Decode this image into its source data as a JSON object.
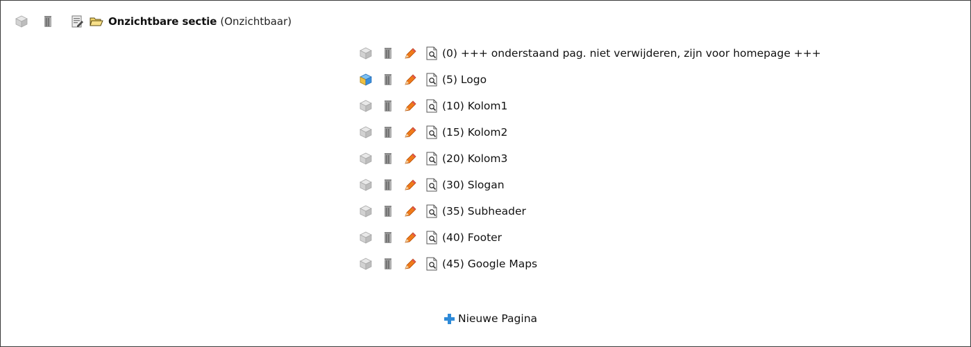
{
  "section": {
    "title": "Onzichtbare sectie",
    "subtitle": "(Onzichtbaar)",
    "icons": [
      "cube-gray-icon",
      "trash-icon",
      "page-edit-icon",
      "folder-open-icon"
    ]
  },
  "pages": [
    {
      "label": "(0) +++ onderstaand pag. niet verwijderen, zijn voor homepage +++",
      "active": false
    },
    {
      "label": "(5) Logo",
      "active": true
    },
    {
      "label": "(10) Kolom1",
      "active": false
    },
    {
      "label": "(15) Kolom2",
      "active": false
    },
    {
      "label": "(20) Kolom3",
      "active": false
    },
    {
      "label": "(30) Slogan",
      "active": false
    },
    {
      "label": "(35) Subheader",
      "active": false
    },
    {
      "label": "(40) Footer",
      "active": false
    },
    {
      "label": "(45) Google Maps",
      "active": false
    }
  ],
  "page_row_icons": [
    "cube-icon",
    "trash-icon",
    "pencil-icon",
    "page-preview-icon"
  ],
  "new_page": {
    "label": "Nieuwe Pagina",
    "icon": "plus-icon"
  },
  "colors": {
    "pencil": "#f07a1a",
    "plus": "#2e8ad8",
    "cube_active": "#3a8fdc",
    "border": "#3a3a3a"
  }
}
